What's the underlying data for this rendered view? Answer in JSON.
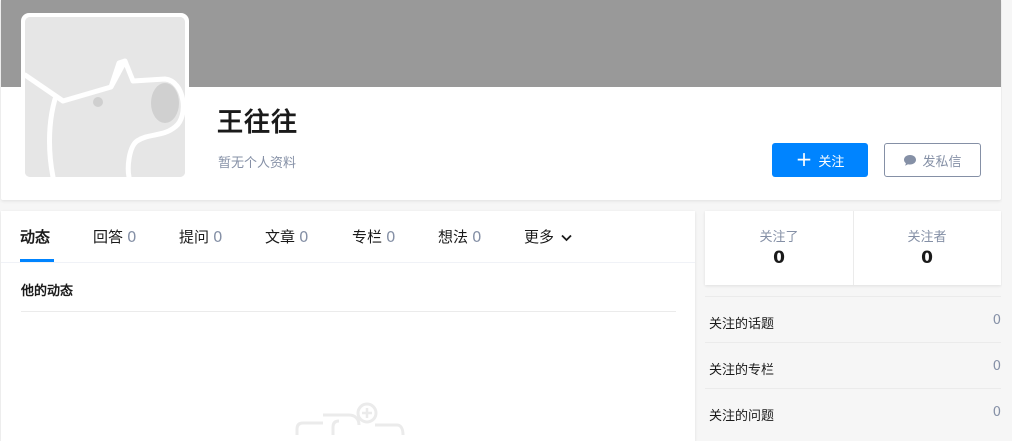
{
  "profile": {
    "name": "王往往",
    "description": "暂无个人资料",
    "follow_label": "关注",
    "message_label": "发私信"
  },
  "tabs": [
    {
      "label": "动态",
      "count": ""
    },
    {
      "label": "回答",
      "count": "0"
    },
    {
      "label": "提问",
      "count": "0"
    },
    {
      "label": "文章",
      "count": "0"
    },
    {
      "label": "专栏",
      "count": "0"
    },
    {
      "label": "想法",
      "count": "0"
    },
    {
      "label": "更多",
      "count": ""
    }
  ],
  "feed": {
    "section_title": "他的动态"
  },
  "stats": {
    "following_label": "关注了",
    "following_value": "0",
    "followers_label": "关注者",
    "followers_value": "0"
  },
  "side_list": [
    {
      "label": "关注的话题",
      "count": "0"
    },
    {
      "label": "关注的专栏",
      "count": "0"
    },
    {
      "label": "关注的问题",
      "count": "0"
    }
  ],
  "colors": {
    "accent": "#0084ff",
    "cover": "#999999",
    "muted": "#8590a6"
  },
  "icons": {
    "plus": "plus-icon",
    "message": "chat-bubble-icon",
    "more": "chevron-down-icon",
    "avatar": "default-avatar-dog-illustration",
    "empty": "empty-state-illustration"
  }
}
